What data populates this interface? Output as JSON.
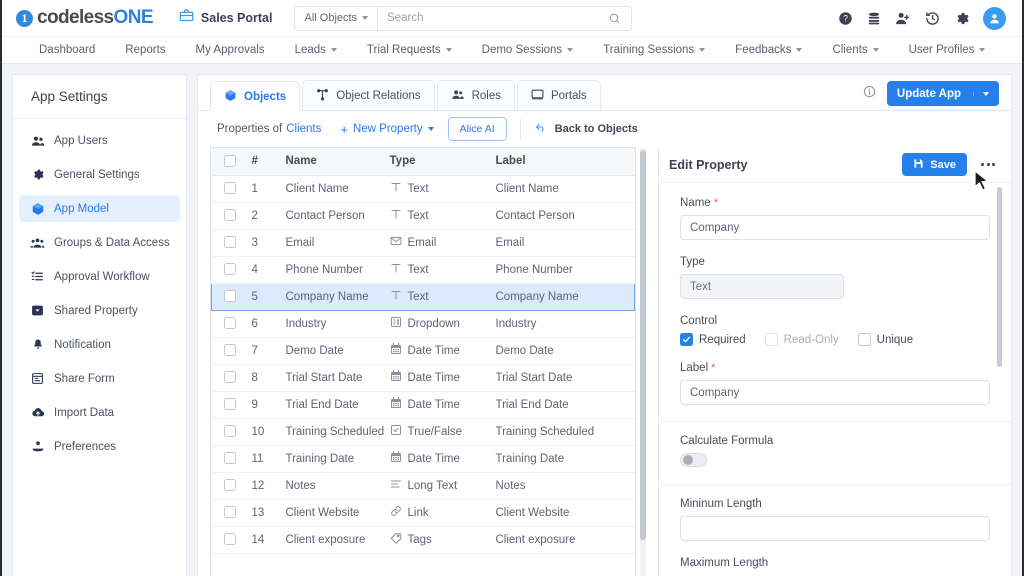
{
  "topbar": {
    "logo_digit": "1",
    "logo_text_a": "codeless",
    "logo_text_b": "ONE",
    "portal_icon": "briefcase-icon",
    "portal_name": "Sales Portal",
    "scope_label": "All Objects",
    "search_value": "",
    "search_placeholder": "Search",
    "icons": [
      "help-icon",
      "database-icon",
      "add-user-icon",
      "history-icon",
      "gear-icon",
      "avatar"
    ]
  },
  "nav": {
    "items": [
      {
        "label": "Dashboard",
        "caret": false
      },
      {
        "label": "Reports",
        "caret": false
      },
      {
        "label": "My Approvals",
        "caret": false
      },
      {
        "label": "Leads",
        "caret": true
      },
      {
        "label": "Trial Requests",
        "caret": true
      },
      {
        "label": "Demo Sessions",
        "caret": true
      },
      {
        "label": "Training Sessions",
        "caret": true
      },
      {
        "label": "Feedbacks",
        "caret": true
      },
      {
        "label": "Clients",
        "caret": true
      },
      {
        "label": "User Profiles",
        "caret": true
      }
    ]
  },
  "sidebar": {
    "title": "App Settings",
    "items": [
      {
        "label": "App Users",
        "icon": "users-icon",
        "active": false
      },
      {
        "label": "General Settings",
        "icon": "gear-icon",
        "active": false
      },
      {
        "label": "App Model",
        "icon": "cube-icon",
        "active": true
      },
      {
        "label": "Groups & Data Access",
        "icon": "group-icon",
        "active": false
      },
      {
        "label": "Approval Workflow",
        "icon": "checklist-icon",
        "active": false
      },
      {
        "label": "Shared Property",
        "icon": "shared-icon",
        "active": false
      },
      {
        "label": "Notification",
        "icon": "bell-icon",
        "active": false
      },
      {
        "label": "Share Form",
        "icon": "form-icon",
        "active": false
      },
      {
        "label": "Import Data",
        "icon": "cloud-upload-icon",
        "active": false
      },
      {
        "label": "Preferences",
        "icon": "preferences-icon",
        "active": false
      }
    ]
  },
  "tabs": [
    {
      "label": "Objects",
      "icon": "cube-icon",
      "active": true
    },
    {
      "label": "Object Relations",
      "icon": "relations-icon",
      "active": false
    },
    {
      "label": "Roles",
      "icon": "users-icon",
      "active": false
    },
    {
      "label": "Portals",
      "icon": "monitor-icon",
      "active": false
    }
  ],
  "toolbar": {
    "info_icon": "info-icon",
    "update_app_label": "Update App"
  },
  "properties_bar": {
    "prefix": "Properties of",
    "object_name": "Clients",
    "new_property_label": "New Property",
    "alice_ai_label": "Alice AI",
    "back_label": "Back to Objects"
  },
  "table": {
    "columns": [
      "#",
      "Name",
      "Type",
      "Label"
    ],
    "rows": [
      {
        "num": "1",
        "name": "Client Name",
        "type": "Text",
        "type_icon": "text-icon",
        "label": "Client Name",
        "selected": false
      },
      {
        "num": "2",
        "name": "Contact Person",
        "type": "Text",
        "type_icon": "text-icon",
        "label": "Contact Person",
        "selected": false
      },
      {
        "num": "3",
        "name": "Email",
        "type": "Email",
        "type_icon": "email-icon",
        "label": "Email",
        "selected": false
      },
      {
        "num": "4",
        "name": "Phone Number",
        "type": "Text",
        "type_icon": "text-icon",
        "label": "Phone Number",
        "selected": false
      },
      {
        "num": "5",
        "name": "Company Name",
        "type": "Text",
        "type_icon": "text-icon",
        "label": "Company Name",
        "selected": true
      },
      {
        "num": "6",
        "name": "Industry",
        "type": "Dropdown",
        "type_icon": "dropdown-icon",
        "label": "Industry",
        "selected": false
      },
      {
        "num": "7",
        "name": "Demo Date",
        "type": "Date Time",
        "type_icon": "calendar-icon",
        "label": "Demo Date",
        "selected": false
      },
      {
        "num": "8",
        "name": "Trial Start Date",
        "type": "Date Time",
        "type_icon": "calendar-icon",
        "label": "Trial Start Date",
        "selected": false
      },
      {
        "num": "9",
        "name": "Trial End Date",
        "type": "Date Time",
        "type_icon": "calendar-icon",
        "label": "Trial End Date",
        "selected": false
      },
      {
        "num": "10",
        "name": "Training Scheduled",
        "type": "True/False",
        "type_icon": "checkbox-icon",
        "label": "Training Scheduled",
        "selected": false
      },
      {
        "num": "11",
        "name": "Training Date",
        "type": "Date Time",
        "type_icon": "calendar-icon",
        "label": "Training Date",
        "selected": false
      },
      {
        "num": "12",
        "name": "Notes",
        "type": "Long Text",
        "type_icon": "lines-icon",
        "label": "Notes",
        "selected": false
      },
      {
        "num": "13",
        "name": "Client Website",
        "type": "Link",
        "type_icon": "link-icon",
        "label": "Client Website",
        "selected": false
      },
      {
        "num": "14",
        "name": "Client exposure",
        "type": "Tags",
        "type_icon": "tag-icon",
        "label": "Client exposure",
        "selected": false
      }
    ]
  },
  "edit_panel": {
    "title": "Edit Property",
    "save_label": "Save",
    "more_icon": "more-horizontal-icon",
    "name_label": "Name",
    "name_value": "Company",
    "type_label": "Type",
    "type_value": "Text",
    "control_label": "Control",
    "controls": [
      {
        "label": "Required",
        "checked": true,
        "disabled": false
      },
      {
        "label": "Read-Only",
        "checked": false,
        "disabled": true
      },
      {
        "label": "Unique",
        "checked": false,
        "disabled": false
      }
    ],
    "label_label": "Label",
    "label_value": "Company",
    "formula_label": "Calculate Formula",
    "formula_on": false,
    "min_length_label": "Mininum Length",
    "min_length_value": "",
    "max_length_label": "Maximum Length"
  },
  "colors": {
    "accent": "#2680eb",
    "link": "#2979e8",
    "selected_row": "#ddeafd",
    "required_star": "#f0506e"
  }
}
